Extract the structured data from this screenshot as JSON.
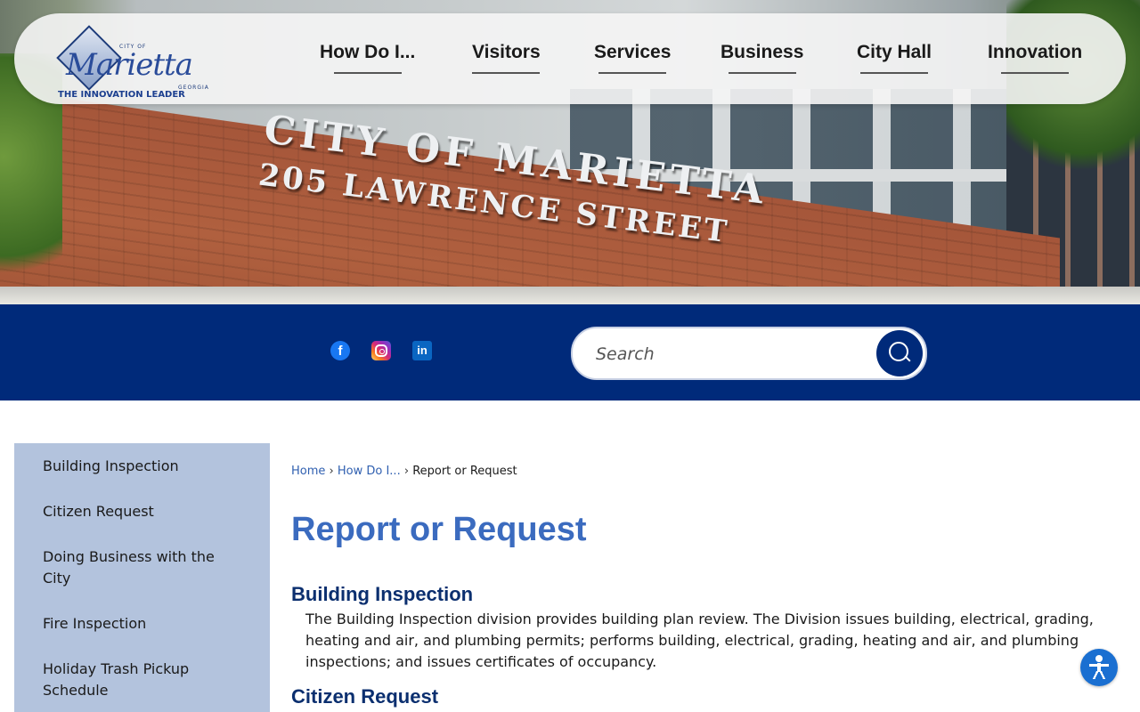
{
  "hero": {
    "sign_line1": "CITY OF MARIETTA",
    "sign_line2": "205 LAWRENCE STREET"
  },
  "logo": {
    "city_of": "CITY OF",
    "name": "Marietta",
    "state": "GEORGIA",
    "tagline": "THE INNOVATION LEADER"
  },
  "nav": {
    "items": [
      "How Do I...",
      "Visitors",
      "Services",
      "Business",
      "City Hall",
      "Innovation"
    ]
  },
  "social": {
    "facebook_icon": "facebook-icon",
    "instagram_icon": "instagram-icon",
    "linkedin_icon": "linkedin-icon"
  },
  "search": {
    "placeholder": "Search",
    "button_icon": "search-icon"
  },
  "sidebar": {
    "items": [
      "Building Inspection",
      "Citizen Request",
      "Doing Business with the City",
      "Fire Inspection",
      "Holiday Trash Pickup Schedule"
    ]
  },
  "breadcrumb": {
    "home": "Home",
    "parent": "How Do I...",
    "current": "Report or Request",
    "separator": "›"
  },
  "main": {
    "title": "Report or Request",
    "sections": [
      {
        "heading": "Building Inspection",
        "body": "The Building Inspection division provides building plan review. The Division issues building, electrical, grading, heating and air, and plumbing permits; performs building, electrical, grading, heating and air, and plumbing inspections; and issues certificates of occupancy."
      },
      {
        "heading": "Citizen Request"
      }
    ]
  },
  "accessibility": {
    "icon": "accessibility-icon"
  },
  "colors": {
    "brand_navy": "#002a7a",
    "title_blue": "#3b6bbf",
    "heading_navy": "#0b2f6f",
    "sidebar_bg": "#b3c3dd"
  }
}
